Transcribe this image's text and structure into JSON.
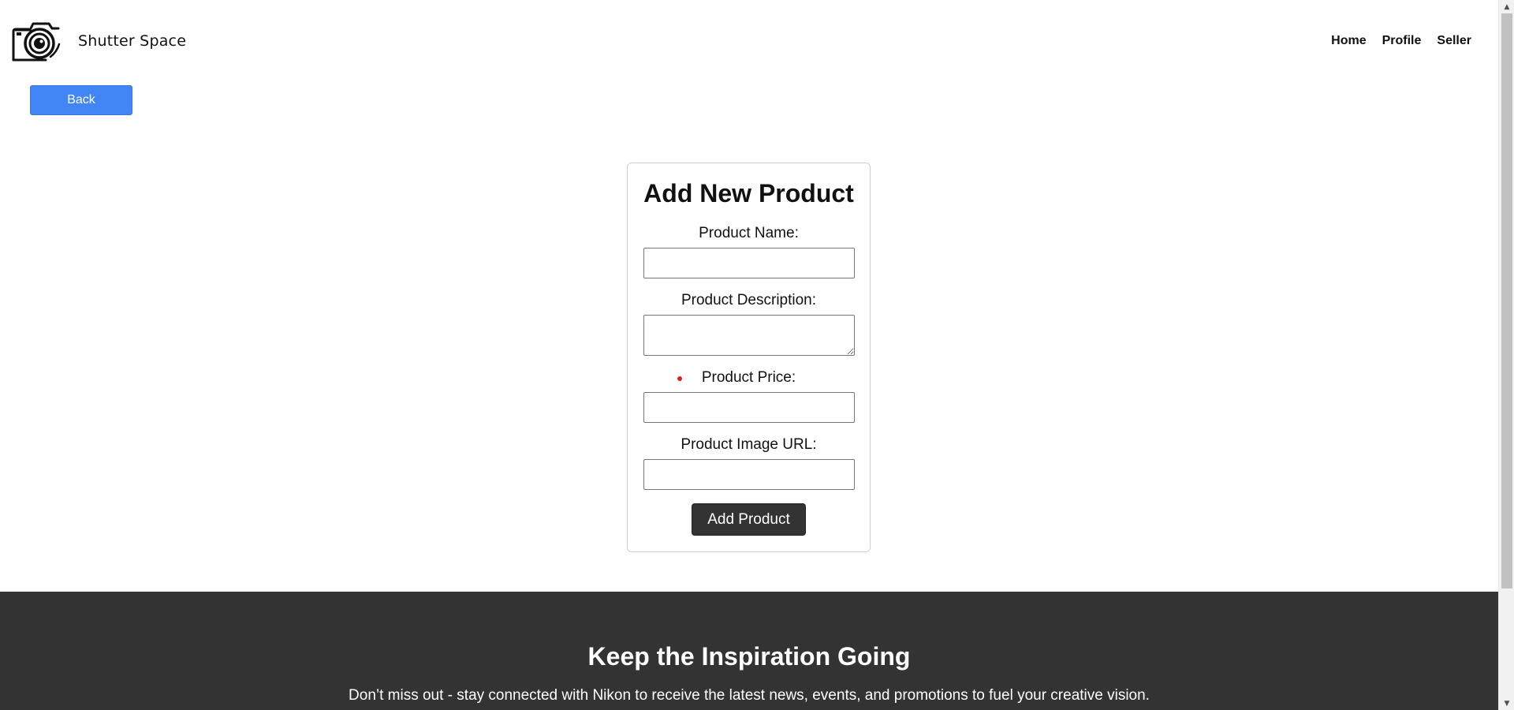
{
  "header": {
    "brand": "Shutter Space",
    "nav": [
      {
        "label": "Home"
      },
      {
        "label": "Profile"
      },
      {
        "label": "Seller"
      }
    ]
  },
  "back_button": {
    "label": "Back"
  },
  "form": {
    "title": "Add New Product",
    "fields": [
      {
        "label": "Product Name:",
        "value": ""
      },
      {
        "label": "Product Description:",
        "value": ""
      },
      {
        "label": "Product Price:",
        "value": ""
      },
      {
        "label": "Product Image URL:",
        "value": ""
      }
    ],
    "submit_label": "Add Product"
  },
  "footer": {
    "heading": "Keep the Inspiration Going",
    "text": "Don’t miss out - stay connected with Nikon to receive the latest news, events, and promotions to fuel your creative vision."
  },
  "colors": {
    "back_button": "#4285f4",
    "submit_button": "#333333",
    "footer_bg": "#333333",
    "required_dot": "#e02020"
  },
  "icons": {
    "logo": "camera-icon"
  }
}
